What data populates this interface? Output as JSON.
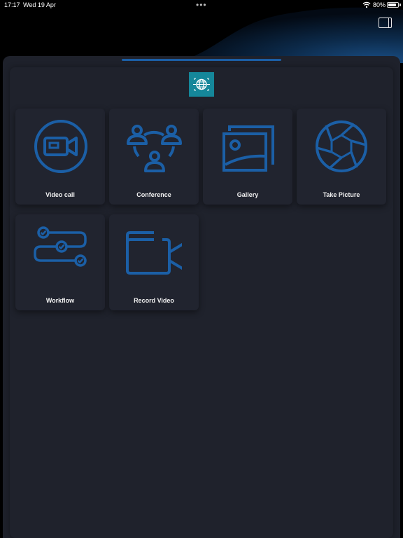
{
  "status_bar": {
    "time": "17:17",
    "date": "Wed 19 Apr",
    "battery": "80%"
  },
  "colors": {
    "accent": "#1b5fa6",
    "sheet": "#1e212b",
    "tile": "#21242f",
    "logo": "#15879a"
  },
  "tiles": [
    {
      "label": "Video call",
      "icon": "video-camera-icon"
    },
    {
      "label": "Conference",
      "icon": "people-group-icon"
    },
    {
      "label": "Gallery",
      "icon": "gallery-icon"
    },
    {
      "label": "Take Picture",
      "icon": "camera-aperture-icon"
    },
    {
      "label": "Workflow",
      "icon": "workflow-icon"
    },
    {
      "label": "Record Video",
      "icon": "record-video-icon"
    }
  ]
}
